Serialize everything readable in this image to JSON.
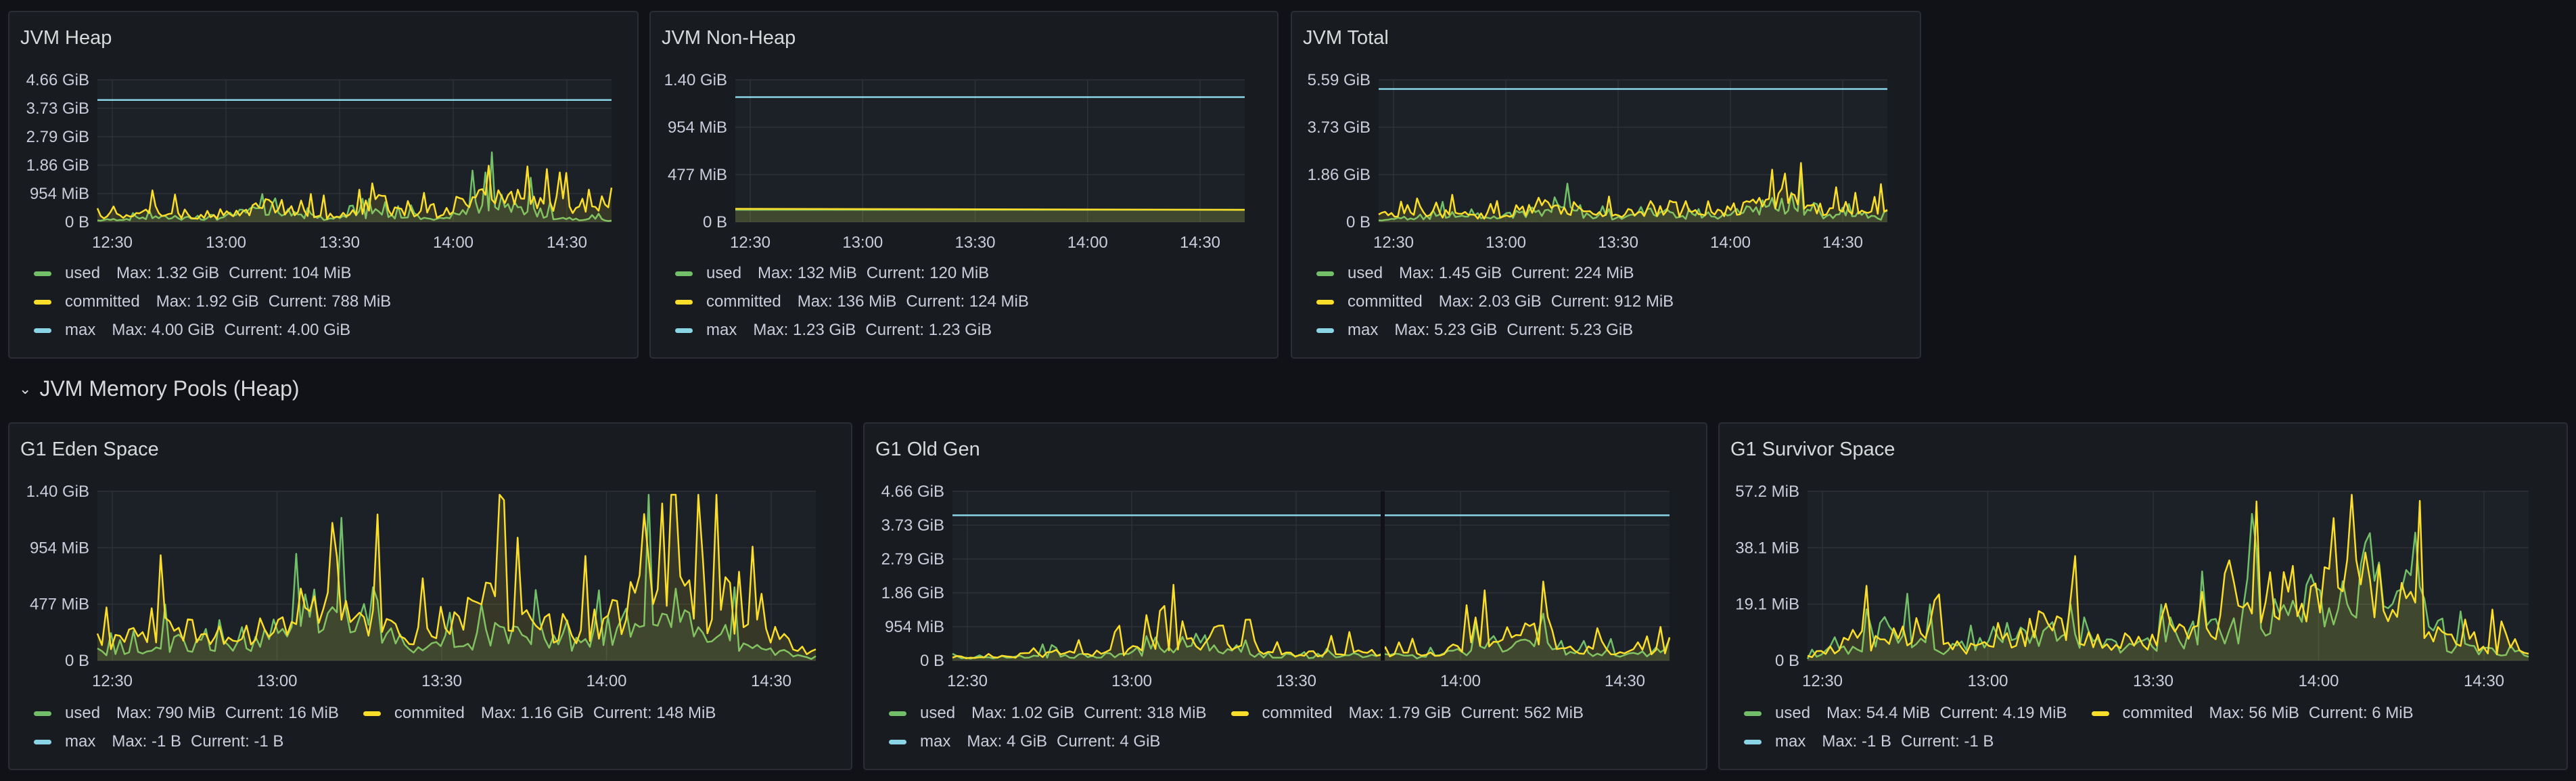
{
  "colors": {
    "used": "#73bf69",
    "committed": "#fade2a",
    "max": "#8ab8ff",
    "maxLine": "#8ad6e6",
    "background": "#111217",
    "panel": "#181b1f"
  },
  "row": {
    "title": "JVM Memory Pools (Heap)",
    "icon": "chevron-down-icon"
  },
  "panels": [
    {
      "title": "JVM Heap",
      "yticks": [
        "4.66 GiB",
        "3.73 GiB",
        "2.79 GiB",
        "1.86 GiB",
        "954 MiB",
        "0 B"
      ],
      "xticks": [
        "12:30",
        "13:00",
        "13:30",
        "14:00",
        "14:30"
      ],
      "legend_rows": [
        [
          {
            "name": "used",
            "color": "#73bf69",
            "max": "Max: 1.32 GiB",
            "current": "Current: 104 MiB"
          }
        ],
        [
          {
            "name": "committed",
            "color": "#fade2a",
            "max": "Max: 1.92 GiB",
            "current": "Current: 788 MiB"
          }
        ],
        [
          {
            "name": "max",
            "color": "#8ad6e6",
            "max": "Max: 4.00 GiB",
            "current": "Current: 4.00 GiB"
          }
        ]
      ]
    },
    {
      "title": "JVM Non-Heap",
      "yticks": [
        "1.40 GiB",
        "954 MiB",
        "477 MiB",
        "0 B"
      ],
      "xticks": [
        "12:30",
        "13:00",
        "13:30",
        "14:00",
        "14:30"
      ],
      "legend_rows": [
        [
          {
            "name": "used",
            "color": "#73bf69",
            "max": "Max: 132 MiB",
            "current": "Current: 120 MiB"
          }
        ],
        [
          {
            "name": "committed",
            "color": "#fade2a",
            "max": "Max: 136 MiB",
            "current": "Current: 124 MiB"
          }
        ],
        [
          {
            "name": "max",
            "color": "#8ad6e6",
            "max": "Max: 1.23 GiB",
            "current": "Current: 1.23 GiB"
          }
        ]
      ]
    },
    {
      "title": "JVM Total",
      "yticks": [
        "5.59 GiB",
        "3.73 GiB",
        "1.86 GiB",
        "0 B"
      ],
      "xticks": [
        "12:30",
        "13:00",
        "13:30",
        "14:00",
        "14:30"
      ],
      "legend_rows": [
        [
          {
            "name": "used",
            "color": "#73bf69",
            "max": "Max: 1.45 GiB",
            "current": "Current: 224 MiB"
          }
        ],
        [
          {
            "name": "committed",
            "color": "#fade2a",
            "max": "Max: 2.03 GiB",
            "current": "Current: 912 MiB"
          }
        ],
        [
          {
            "name": "max",
            "color": "#8ad6e6",
            "max": "Max: 5.23 GiB",
            "current": "Current: 5.23 GiB"
          }
        ]
      ]
    },
    {
      "title": "G1 Eden Space",
      "yticks": [
        "1.40 GiB",
        "954 MiB",
        "477 MiB",
        "0 B"
      ],
      "xticks": [
        "12:30",
        "13:00",
        "13:30",
        "14:00",
        "14:30"
      ],
      "legend_rows": [
        [
          {
            "name": "used",
            "color": "#73bf69",
            "max": "Max: 790 MiB",
            "current": "Current: 16 MiB"
          },
          {
            "name": "commited",
            "color": "#fade2a",
            "max": "Max: 1.16 GiB",
            "current": "Current: 148 MiB"
          }
        ],
        [
          {
            "name": "max",
            "color": "#8ad6e6",
            "max": "Max: -1 B",
            "current": "Current: -1 B"
          }
        ]
      ]
    },
    {
      "title": "G1 Old Gen",
      "yticks": [
        "4.66 GiB",
        "3.73 GiB",
        "2.79 GiB",
        "1.86 GiB",
        "954 MiB",
        "0 B"
      ],
      "xticks": [
        "12:30",
        "13:00",
        "13:30",
        "14:00",
        "14:30"
      ],
      "legend_rows": [
        [
          {
            "name": "used",
            "color": "#73bf69",
            "max": "Max: 1.02 GiB",
            "current": "Current: 318 MiB"
          },
          {
            "name": "commited",
            "color": "#fade2a",
            "max": "Max: 1.79 GiB",
            "current": "Current: 562 MiB"
          }
        ],
        [
          {
            "name": "max",
            "color": "#8ad6e6",
            "max": "Max: 4 GiB",
            "current": "Current: 4 GiB"
          }
        ]
      ]
    },
    {
      "title": "G1 Survivor Space",
      "yticks": [
        "57.2 MiB",
        "38.1 MiB",
        "19.1 MiB",
        "0 B"
      ],
      "xticks": [
        "12:30",
        "13:00",
        "13:30",
        "14:00",
        "14:30"
      ],
      "legend_rows": [
        [
          {
            "name": "used",
            "color": "#73bf69",
            "max": "Max: 54.4 MiB",
            "current": "Current: 4.19 MiB"
          },
          {
            "name": "commited",
            "color": "#fade2a",
            "max": "Max: 56 MiB",
            "current": "Current: 6 MiB"
          }
        ],
        [
          {
            "name": "max",
            "color": "#8ad6e6",
            "max": "Max: -1 B",
            "current": "Current: -1 B"
          }
        ]
      ]
    }
  ],
  "chart_data": [
    {
      "type": "line",
      "title": "JVM Heap",
      "x": [
        "12:30",
        "13:00",
        "13:30",
        "14:00",
        "14:30"
      ],
      "ylim": [
        0,
        4.66
      ],
      "yunit": "GiB",
      "series": [
        {
          "name": "used",
          "pattern": "spiky",
          "values": [
            0.1,
            0.3,
            0.2,
            0.9,
            0.2,
            0.5,
            0.2,
            1.3,
            0.3,
            0.1
          ]
        },
        {
          "name": "committed",
          "pattern": "spiky",
          "values": [
            0.4,
            0.6,
            0.3,
            1.1,
            0.4,
            0.7,
            0.5,
            1.92,
            0.8,
            0.79
          ]
        },
        {
          "name": "max",
          "pattern": "flat",
          "values": [
            4.0,
            4.0,
            4.0,
            4.0,
            4.0,
            4.0,
            4.0,
            4.0,
            4.0,
            4.0
          ]
        }
      ]
    },
    {
      "type": "line",
      "title": "JVM Non-Heap",
      "x": [
        "12:30",
        "13:00",
        "13:30",
        "14:00",
        "14:30"
      ],
      "ylim": [
        0,
        1.4
      ],
      "yunit": "GiB",
      "series": [
        {
          "name": "used",
          "pattern": "flat",
          "values": [
            0.12,
            0.12,
            0.12,
            0.12,
            0.12,
            0.12,
            0.11,
            0.12,
            0.12,
            0.12
          ]
        },
        {
          "name": "committed",
          "pattern": "flat",
          "values": [
            0.13,
            0.13,
            0.13,
            0.13,
            0.13,
            0.13,
            0.11,
            0.12,
            0.12,
            0.12
          ]
        },
        {
          "name": "max",
          "pattern": "flat",
          "values": [
            1.23,
            1.23,
            1.23,
            1.23,
            1.23,
            1.23,
            1.23,
            1.23,
            1.23,
            1.23
          ]
        }
      ]
    },
    {
      "type": "line",
      "title": "JVM Total",
      "x": [
        "12:30",
        "13:00",
        "13:30",
        "14:00",
        "14:30"
      ],
      "ylim": [
        0,
        5.59
      ],
      "yunit": "GiB",
      "series": [
        {
          "name": "used",
          "pattern": "spiky",
          "values": [
            0.2,
            0.4,
            0.3,
            1.0,
            0.3,
            0.6,
            0.3,
            1.45,
            0.4,
            0.22
          ]
        },
        {
          "name": "committed",
          "pattern": "spiky",
          "values": [
            0.5,
            0.7,
            0.4,
            1.2,
            0.5,
            0.8,
            0.6,
            2.03,
            0.9,
            0.91
          ]
        },
        {
          "name": "max",
          "pattern": "flat",
          "values": [
            5.23,
            5.23,
            5.23,
            5.23,
            5.23,
            5.23,
            5.23,
            5.23,
            5.23,
            5.23
          ]
        }
      ]
    },
    {
      "type": "line",
      "title": "G1 Eden Space",
      "x": [
        "12:30",
        "13:00",
        "13:30",
        "14:00",
        "14:30"
      ],
      "ylim": [
        0,
        1.4
      ],
      "yunit": "GiB",
      "series": [
        {
          "name": "used",
          "pattern": "spiky",
          "values": [
            0.1,
            0.3,
            0.2,
            0.7,
            0.2,
            0.4,
            0.3,
            0.77,
            0.3,
            0.02
          ]
        },
        {
          "name": "commited",
          "pattern": "spiky",
          "values": [
            0.3,
            0.5,
            0.3,
            0.9,
            0.4,
            0.8,
            0.4,
            1.16,
            0.6,
            0.14
          ]
        },
        {
          "name": "max",
          "pattern": "flat",
          "values": [
            0,
            0,
            0,
            0,
            0,
            0,
            0,
            0,
            0,
            0
          ]
        }
      ]
    },
    {
      "type": "line",
      "title": "G1 Old Gen",
      "x": [
        "12:30",
        "13:00",
        "13:30",
        "14:00",
        "14:30"
      ],
      "ylim": [
        0,
        4.66
      ],
      "yunit": "GiB",
      "series": [
        {
          "name": "used",
          "pattern": "spiky",
          "values": [
            0.1,
            0.2,
            0.3,
            0.6,
            0.2,
            0.3,
            0.2,
            1.02,
            0.3,
            0.31
          ]
        },
        {
          "name": "commited",
          "pattern": "spiky",
          "values": [
            0.2,
            0.3,
            0.4,
            1.2,
            0.3,
            0.4,
            0.3,
            1.79,
            0.5,
            0.55
          ]
        },
        {
          "name": "max",
          "pattern": "flat",
          "values": [
            4,
            4,
            4,
            4,
            4,
            4,
            4,
            4,
            4,
            4
          ]
        }
      ]
    },
    {
      "type": "line",
      "title": "G1 Survivor Space",
      "x": [
        "12:30",
        "13:00",
        "13:30",
        "14:00",
        "14:30"
      ],
      "ylim": [
        0,
        57.2
      ],
      "yunit": "MiB",
      "series": [
        {
          "name": "used",
          "pattern": "spiky",
          "values": [
            2,
            14,
            6,
            20,
            8,
            18,
            30,
            54.4,
            10,
            4.19
          ]
        },
        {
          "name": "commited",
          "pattern": "spiky",
          "values": [
            3,
            16,
            8,
            22,
            10,
            20,
            34,
            56,
            12,
            6
          ]
        },
        {
          "name": "max",
          "pattern": "flat",
          "values": [
            0,
            0,
            0,
            0,
            0,
            0,
            0,
            0,
            0,
            0
          ]
        }
      ]
    }
  ]
}
